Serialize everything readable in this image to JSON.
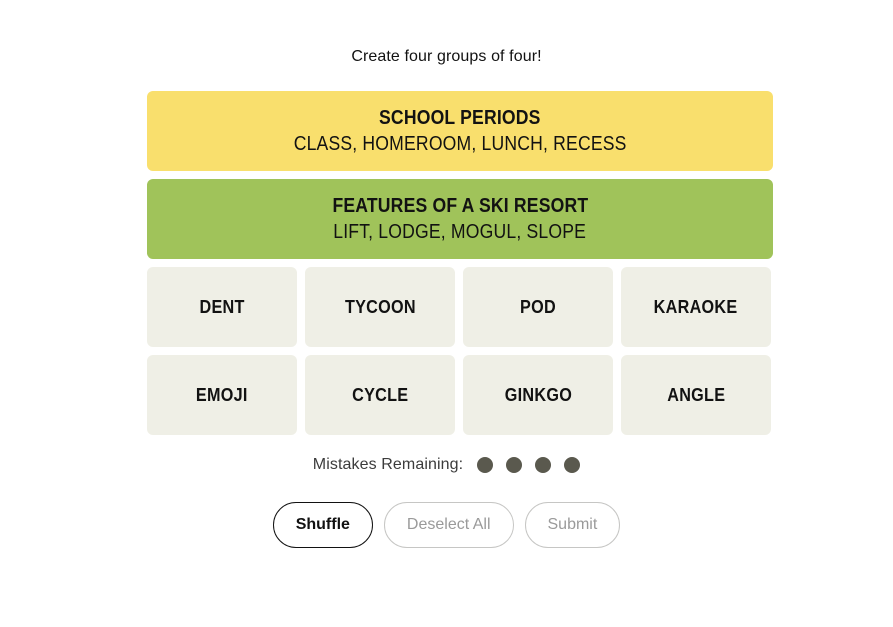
{
  "instruction": "Create four groups of four!",
  "solved_groups": [
    {
      "category": "SCHOOL PERIODS",
      "members": "CLASS, HOMEROOM, LUNCH, RECESS",
      "color": "#f9df6d",
      "difficulty": "yellow"
    },
    {
      "category": "FEATURES OF A SKI RESORT",
      "members": "LIFT, LODGE, MOGUL, SLOPE",
      "color": "#a0c35a",
      "difficulty": "green"
    }
  ],
  "tiles": [
    [
      {
        "label": "DENT"
      },
      {
        "label": "TYCOON"
      },
      {
        "label": "POD"
      },
      {
        "label": "KARAOKE"
      }
    ],
    [
      {
        "label": "EMOJI"
      },
      {
        "label": "CYCLE"
      },
      {
        "label": "GINKGO"
      },
      {
        "label": "ANGLE"
      }
    ]
  ],
  "mistakes": {
    "label": "Mistakes Remaining:",
    "remaining": 4,
    "dot_color": "#5a594e"
  },
  "buttons": {
    "shuffle": {
      "label": "Shuffle",
      "enabled": true
    },
    "deselect": {
      "label": "Deselect All",
      "enabled": false
    },
    "submit": {
      "label": "Submit",
      "enabled": false
    }
  },
  "theme": {
    "background": "#ffffff",
    "tile_background": "#efefe6",
    "text": "#121212"
  }
}
